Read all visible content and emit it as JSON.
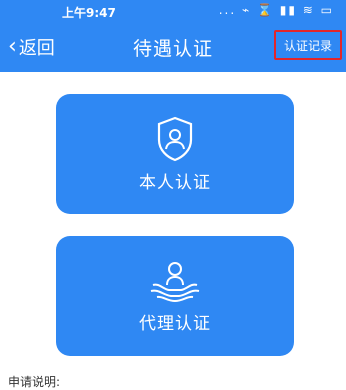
{
  "status_bar": {
    "time": "上午9:47",
    "icons_text": "... ⌁ ⌛ ▮▮ ≋ ▭"
  },
  "nav": {
    "back_label": "返回",
    "title": "待遇认证",
    "records_label": "认证记录"
  },
  "cards": {
    "self": {
      "label": "本人认证",
      "icon": "shield-user-icon"
    },
    "proxy": {
      "label": "代理认证",
      "icon": "hands-person-icon"
    }
  },
  "description_label": "申请说明:",
  "colors": {
    "primary": "#2f88f3",
    "highlight_border": "#e3262a",
    "background": "#ffffff"
  }
}
